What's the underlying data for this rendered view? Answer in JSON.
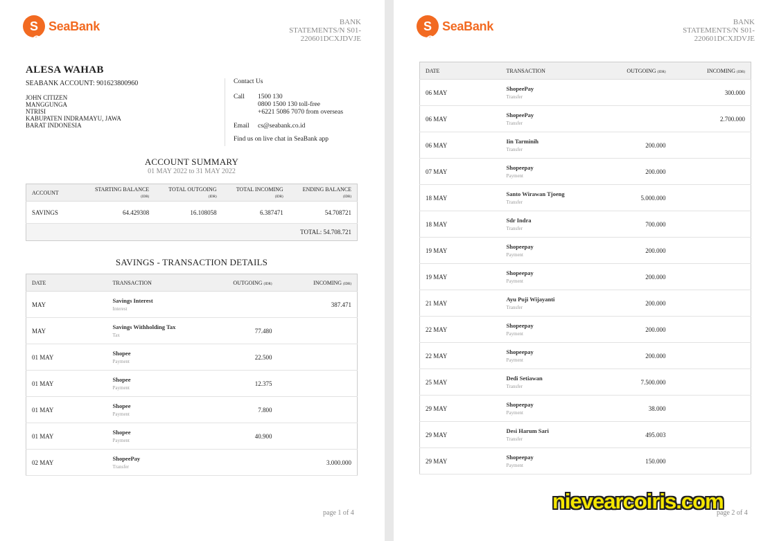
{
  "brand": {
    "name": "SeaBank",
    "logo_letter": "S"
  },
  "statement_ref": {
    "line1": "BANK",
    "line2": "STATEMENTS/N S01-",
    "line3": "220601DCXJDVJE"
  },
  "holder": {
    "name": "ALESA WAHAB",
    "account_line": "SEABANK ACCOUNT: 901623800960",
    "address": [
      "JOHN CITIZEN",
      "MANGGUNGA",
      "NTRISI",
      "KABUPATEN INDRAMAYU, JAWA",
      "BARAT INDONESIA"
    ]
  },
  "contact": {
    "title": "Contact Us",
    "call_label": "Call",
    "call_lines": [
      "1500 130",
      "0800 1500 130 toll-free",
      "+6221 5086 7070 from overseas"
    ],
    "email_label": "Email",
    "email": "cs@seabank.co.id",
    "chat": "Find us on live chat in SeaBank app"
  },
  "summary": {
    "title": "ACCOUNT SUMMARY",
    "period": "01 MAY 2022 to 31 MAY 2022",
    "headers": {
      "account": "ACCOUNT",
      "start": "STARTING BALANCE",
      "out": "TOTAL OUTGOING",
      "in": "TOTAL INCOMING",
      "end": "ENDING BALANCE",
      "unit": "(IDR)"
    },
    "row": {
      "account": "SAVINGS",
      "start": "64.429308",
      "out": "16.108058",
      "in": "6.387471",
      "end": "54.708721"
    },
    "total": "TOTAL: 54.708.721"
  },
  "tx_headers": {
    "date": "DATE",
    "transaction": "TRANSACTION",
    "outgoing": "OUTGOING",
    "incoming": "INCOMING",
    "unit": "(IDR)"
  },
  "details_title": "SAVINGS - TRANSACTION DETAILS",
  "page1_tx": [
    {
      "date": "MAY",
      "name": "Savings  Interest",
      "type": "Interest",
      "out": "",
      "in": "387.471"
    },
    {
      "date": "MAY",
      "name": "Savings Withholding Tax",
      "type": "Tax",
      "out": "77.480",
      "in": ""
    },
    {
      "date": "01 MAY",
      "name": "Shopee",
      "type": "Payment",
      "out": "22.500",
      "in": ""
    },
    {
      "date": "01 MAY",
      "name": "Shopee",
      "type": "Payment",
      "out": "12.375",
      "in": ""
    },
    {
      "date": "01 MAY",
      "name": "Shopee",
      "type": "Payment",
      "out": "7.800",
      "in": ""
    },
    {
      "date": "01 MAY",
      "name": "Shopee",
      "type": "Payment",
      "out": "40.900",
      "in": ""
    },
    {
      "date": "02 MAY",
      "name": "ShopeePay",
      "type": "Transfer",
      "out": "",
      "in": "3.000.000"
    }
  ],
  "page2_tx": [
    {
      "date": "06 MAY",
      "name": "ShopeePay",
      "type": "Transfer",
      "out": "",
      "in": "300.000"
    },
    {
      "date": "06 MAY",
      "name": "ShopeePay",
      "type": "Transfer",
      "out": "",
      "in": "2.700.000"
    },
    {
      "date": "06 MAY",
      "name": "Iin Tarminih",
      "type": "Transfer",
      "out": "200.000",
      "in": ""
    },
    {
      "date": "07 MAY",
      "name": "Shopeepay",
      "type": "Payment",
      "out": "200.000",
      "in": ""
    },
    {
      "date": "18 MAY",
      "name": "Santo Wirawan Tjoeng",
      "type": "Transfer",
      "out": "5.000.000",
      "in": ""
    },
    {
      "date": "18 MAY",
      "name": "Sdr Indra",
      "type": "Transfer",
      "out": "700.000",
      "in": ""
    },
    {
      "date": "19 MAY",
      "name": "Shopeepay",
      "type": "Payment",
      "out": "200.000",
      "in": ""
    },
    {
      "date": "19 MAY",
      "name": "Shopeepay",
      "type": "Payment",
      "out": "200.000",
      "in": ""
    },
    {
      "date": "21 MAY",
      "name": "Ayu Puji Wijayanti",
      "type": "Transfer",
      "out": "200.000",
      "in": ""
    },
    {
      "date": "22 MAY",
      "name": "Shopeepay",
      "type": "Payment",
      "out": "200.000",
      "in": ""
    },
    {
      "date": "22 MAY",
      "name": "Shopeepay",
      "type": "Payment",
      "out": "200.000",
      "in": ""
    },
    {
      "date": "25 MAY",
      "name": "Dedi Setiawan",
      "type": "Transfer",
      "out": "7.500.000",
      "in": ""
    },
    {
      "date": "29 MAY",
      "name": "Shopeepay",
      "type": "Payment",
      "out": "38.000",
      "in": ""
    },
    {
      "date": "29 MAY",
      "name": "Desi Harum Sari",
      "type": "Transfer",
      "out": "495.003",
      "in": ""
    },
    {
      "date": "29 MAY",
      "name": "Shopeepay",
      "type": "Payment",
      "out": "150.000",
      "in": ""
    }
  ],
  "footer": {
    "page1": "page 1 of 4",
    "page2": "page 2 of 4"
  },
  "watermark": "nievearcoiris.com",
  "colors": {
    "brand_orange": "#f26a21",
    "watermark_yellow": "#f5e600"
  }
}
